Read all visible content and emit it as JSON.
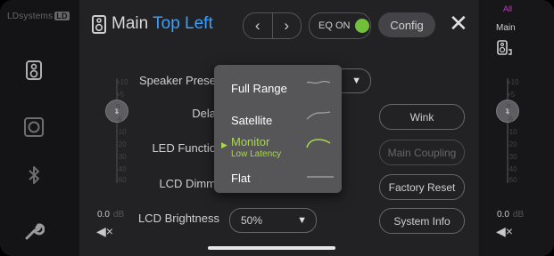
{
  "brand": {
    "name": "LDsystems",
    "badge": "LD"
  },
  "header": {
    "title_main": "Main",
    "title_accent": "Top Left",
    "prev_icon": "chevron-left-icon",
    "next_icon": "chevron-right-icon",
    "eq_label": "EQ ON",
    "eq_state": "on",
    "config_label": "Config",
    "close_icon": "close-icon"
  },
  "left_rail": {
    "icons": [
      "speaker-icon",
      "subwoofer-icon",
      "bluetooth-icon",
      "wrench-icon"
    ]
  },
  "left_fader": {
    "ticks": [
      "+10",
      "+5",
      "0",
      "-5",
      "-10",
      "-20",
      "-30",
      "-40",
      "-60"
    ],
    "value": "0.0",
    "unit": "dB",
    "level": 0.0,
    "mute_icon": "mute-icon"
  },
  "right_rail": {
    "group_label": "All",
    "channel_label": "Main",
    "speaker_icon": "speaker-link-icon"
  },
  "right_fader": {
    "ticks": [
      "+10",
      "+5",
      "0",
      "-5",
      "-10",
      "-20",
      "-30",
      "-40",
      "-60"
    ],
    "value": "0.0",
    "unit": "dB",
    "level": 0.0,
    "mute_icon": "mute-icon"
  },
  "settings": {
    "speaker_preset_label": "Speaker Prese",
    "delay_label": "Dela",
    "led_function_label": "LED Functio",
    "lcd_dimmer_label": "LCD Dimm",
    "lcd_brightness_label": "LCD Brightness",
    "lcd_brightness_value": "50%"
  },
  "buttons": {
    "wink": "Wink",
    "main_coupling": "Main Coupling",
    "factory_reset": "Factory Reset",
    "system_info": "System Info"
  },
  "preset_menu": {
    "items": [
      {
        "label": "Full Range",
        "sublabel": "",
        "selected": false
      },
      {
        "label": "Satellite",
        "sublabel": "",
        "selected": false
      },
      {
        "label": "Monitor",
        "sublabel": "Low Latency",
        "selected": true
      },
      {
        "label": "Flat",
        "sublabel": "",
        "selected": false
      }
    ]
  },
  "colors": {
    "accent_blue": "#3aa0ff",
    "accent_green": "#a8d84a",
    "eq_on_green": "#70c03c",
    "all_magenta": "#c040c0"
  }
}
